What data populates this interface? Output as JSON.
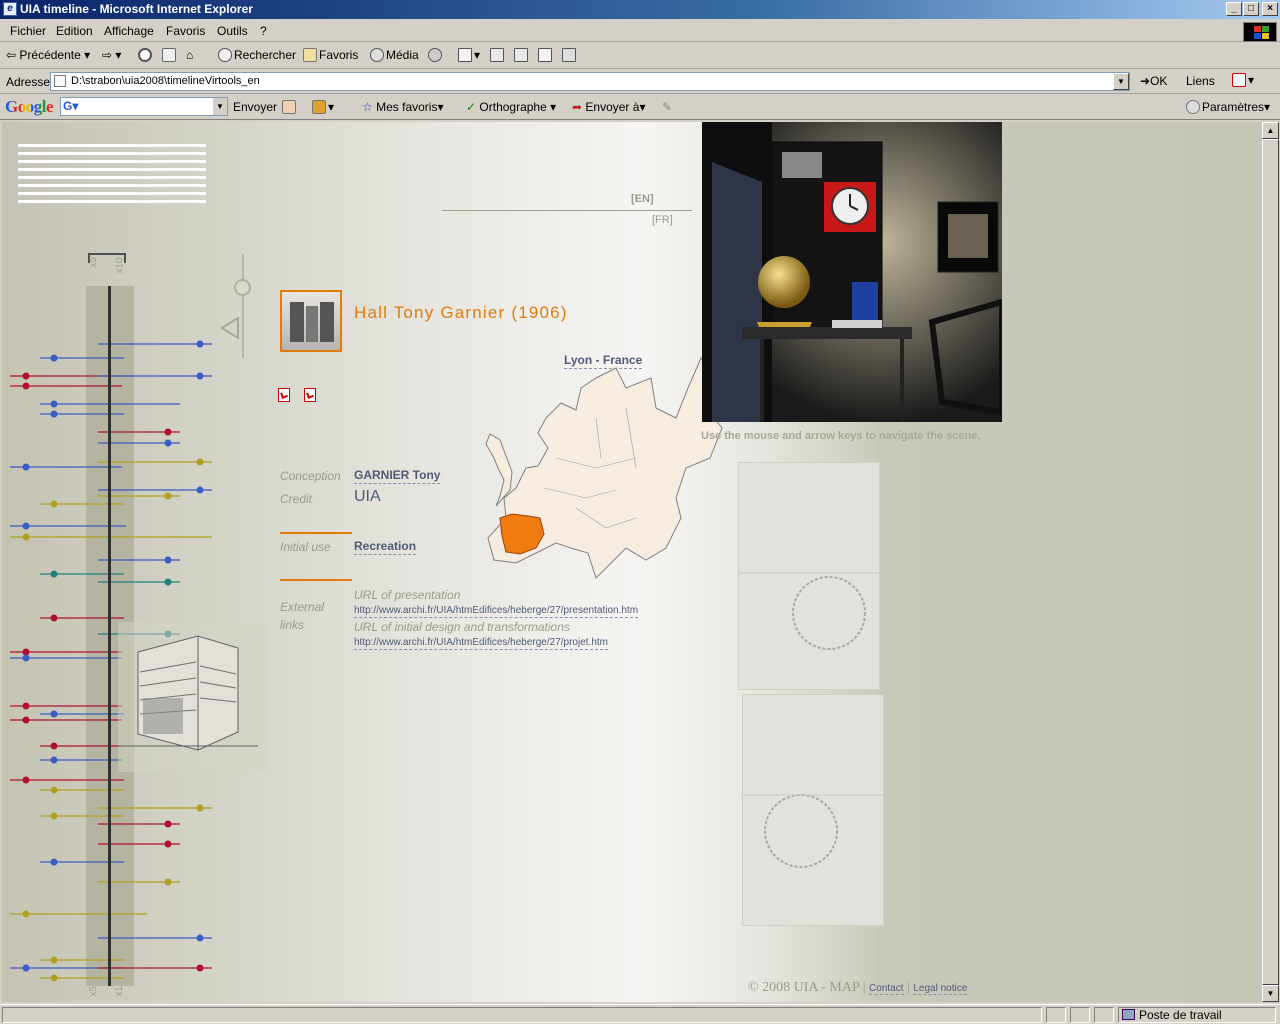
{
  "window": {
    "title": "UIA timeline - Microsoft Internet Explorer"
  },
  "menu": [
    "Fichier",
    "Edition",
    "Affichage",
    "Favoris",
    "Outils",
    "?"
  ],
  "toolbar": {
    "back": "Précédente",
    "search": "Rechercher",
    "favorites": "Favoris",
    "media": "Média"
  },
  "address": {
    "label": "Adresse",
    "value": "D:\\strabon\\uia2008\\timelineVirtools_en",
    "go": "OK",
    "links": "Liens"
  },
  "googlebar": {
    "logo": "Google",
    "send": "Envoyer",
    "my_favorites": "Mes favoris",
    "spell": "Orthographe",
    "send_to": "Envoyer à",
    "settings": "Paramètres"
  },
  "page": {
    "lang_en": "[EN]",
    "lang_fr": "[FR]",
    "zoom_x5": "x5",
    "zoom_x10": "x10",
    "zoom_x5_bottom": "x5",
    "zoom_x1_bottom": "x1",
    "title": "Hall Tony Garnier (1906)",
    "location_city": "Lyon",
    "location_country": "France",
    "conception_label": "Conception",
    "conception_value": "GARNIER Tony",
    "credit_label": "Credit",
    "credit_value": "UIA",
    "initial_use_label": "Initial use",
    "initial_use_value": "Recreation",
    "external_label_1": "External",
    "external_label_2": "links",
    "url_presentation_label": "URL of presentation",
    "url_presentation": "http://www.archi.fr/UIA/htmEdifices/heberge/27/presentation.htm",
    "url_design_label": "URL of initial design and transformations",
    "url_design": "http://www.archi.fr/UIA/htmEdifices/heberge/27/projet.htm",
    "hint": "Use the mouse and arrow keys to navigate the scene.",
    "footer_copy": "© 2008 UIA - MAP",
    "footer_contact": "Contact",
    "footer_legal": "Legal notice"
  },
  "status": {
    "zone": "Poste de travail"
  },
  "colors": {
    "accent": "#e07b10",
    "link": "#505a78",
    "blue": "#3b5cc4",
    "red": "#b01030",
    "olive": "#b0a020",
    "teal": "#208080"
  }
}
